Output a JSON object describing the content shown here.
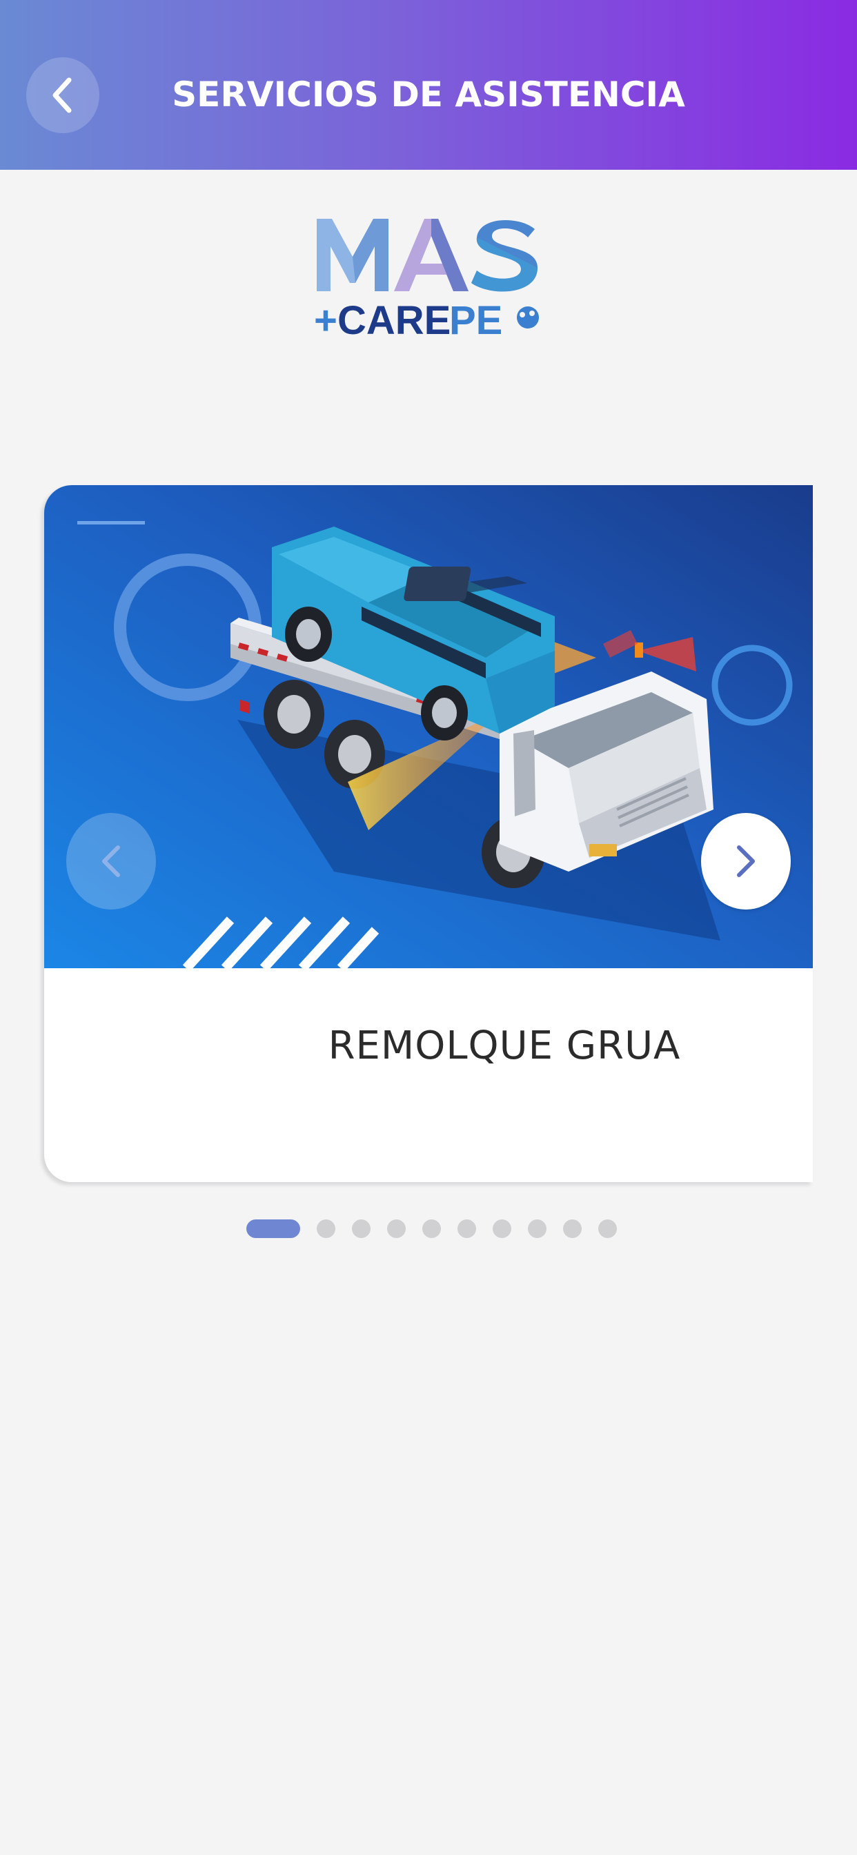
{
  "header": {
    "title": "SERVICIOS DE ASISTENCIA",
    "back_icon": "chevron-left-icon"
  },
  "logo": {
    "line1": "MAS",
    "line2": "+CAREPET"
  },
  "carousel": {
    "current_slide_label": "REMOLQUE GRUA",
    "prev_icon": "chevron-left-icon",
    "next_icon": "chevron-right-icon",
    "total_slides": 10,
    "active_index": 0
  },
  "colors": {
    "header_start": "#6a8ad4",
    "header_end": "#8a2be2",
    "card_blue": "#1e5fc0",
    "active_dot": "#6f87d3",
    "inactive_dot": "#d0d0d3"
  }
}
